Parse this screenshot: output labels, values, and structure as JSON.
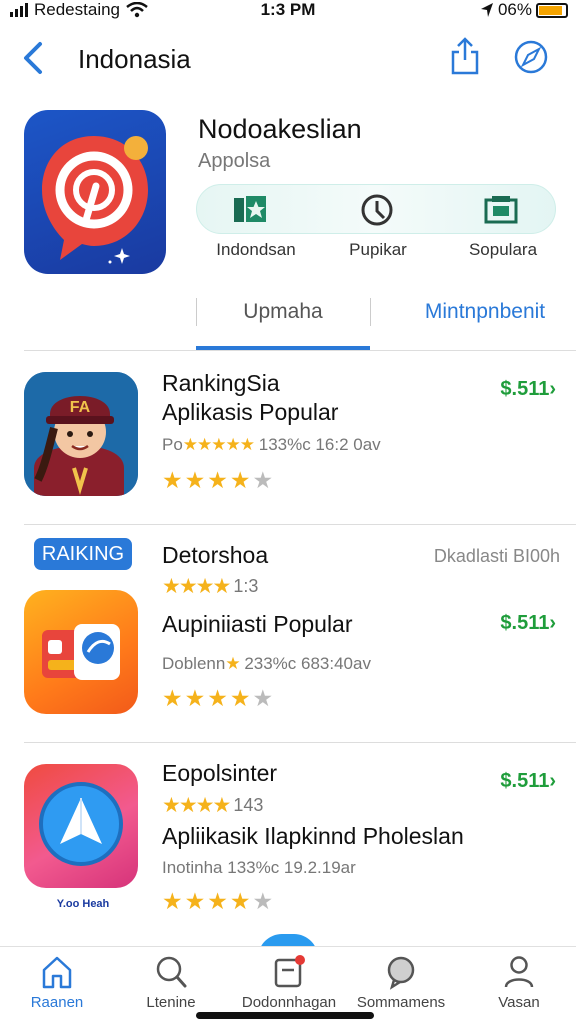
{
  "status": {
    "carrier": "Redestaing",
    "time": "1:3 PM",
    "battery": "06%",
    "battery_level": 0.9
  },
  "nav": {
    "title": "Indonasia",
    "back_icon": "chevron-left-icon",
    "share_icon": "share-icon",
    "compass_icon": "compass-icon"
  },
  "app": {
    "name": "Nodoakeslian",
    "developer": "Appolsa",
    "actions": [
      {
        "label": "Indondsan",
        "icon": "star-flag-icon"
      },
      {
        "label": "Pupikar",
        "icon": "clock-icon"
      },
      {
        "label": "Sopulara",
        "icon": "bookmark-icon"
      }
    ]
  },
  "segments": {
    "tab1": "Upmaha",
    "tab2": "Mintnpnbenit"
  },
  "list": [
    {
      "title": "RankingSia",
      "subtitle": "Aplikasis Popular",
      "meta_prefix": "Po",
      "meta_stars": "★★★★★",
      "meta_suffix": "133%c 16:2 0av",
      "rating": 4,
      "price": "$.511›"
    },
    {
      "badge": "RAIKING",
      "title": "Detorshoa",
      "right_text": "Dkadlasti BI00h",
      "rating_inline_stars": "★★★★",
      "rating_inline_text": "1:3",
      "subtitle": "Aupiniiasti Popular",
      "meta_prefix": "Doblenn",
      "meta_stars": "★",
      "meta_suffix": "233%c 683:40av",
      "rating": 4,
      "price": "$.511›"
    },
    {
      "title": "Eopolsinter",
      "rating_inline_stars": "★★★★",
      "rating_inline_text": "143",
      "subtitle": "Apliikasik Ilapkinnd Pholeslan",
      "meta_prefix": "Inotinha",
      "meta_stars": "",
      "meta_suffix": "133%c 19.2.19ar",
      "icon_caption": "Y.oo Heah",
      "rating": 4,
      "price": "$.511›"
    }
  ],
  "tabs": [
    {
      "label": "Raanen",
      "icon": "home-icon"
    },
    {
      "label": "Ltenine",
      "icon": "search-icon"
    },
    {
      "label": "Dodonnhagan",
      "icon": "notification-icon"
    },
    {
      "label": "Sommamens",
      "icon": "chat-icon"
    },
    {
      "label": "Vasan",
      "icon": "profile-icon"
    }
  ],
  "colors": {
    "accent": "#2a79d8",
    "price": "#1f9d3b",
    "star": "#f5b21b"
  }
}
